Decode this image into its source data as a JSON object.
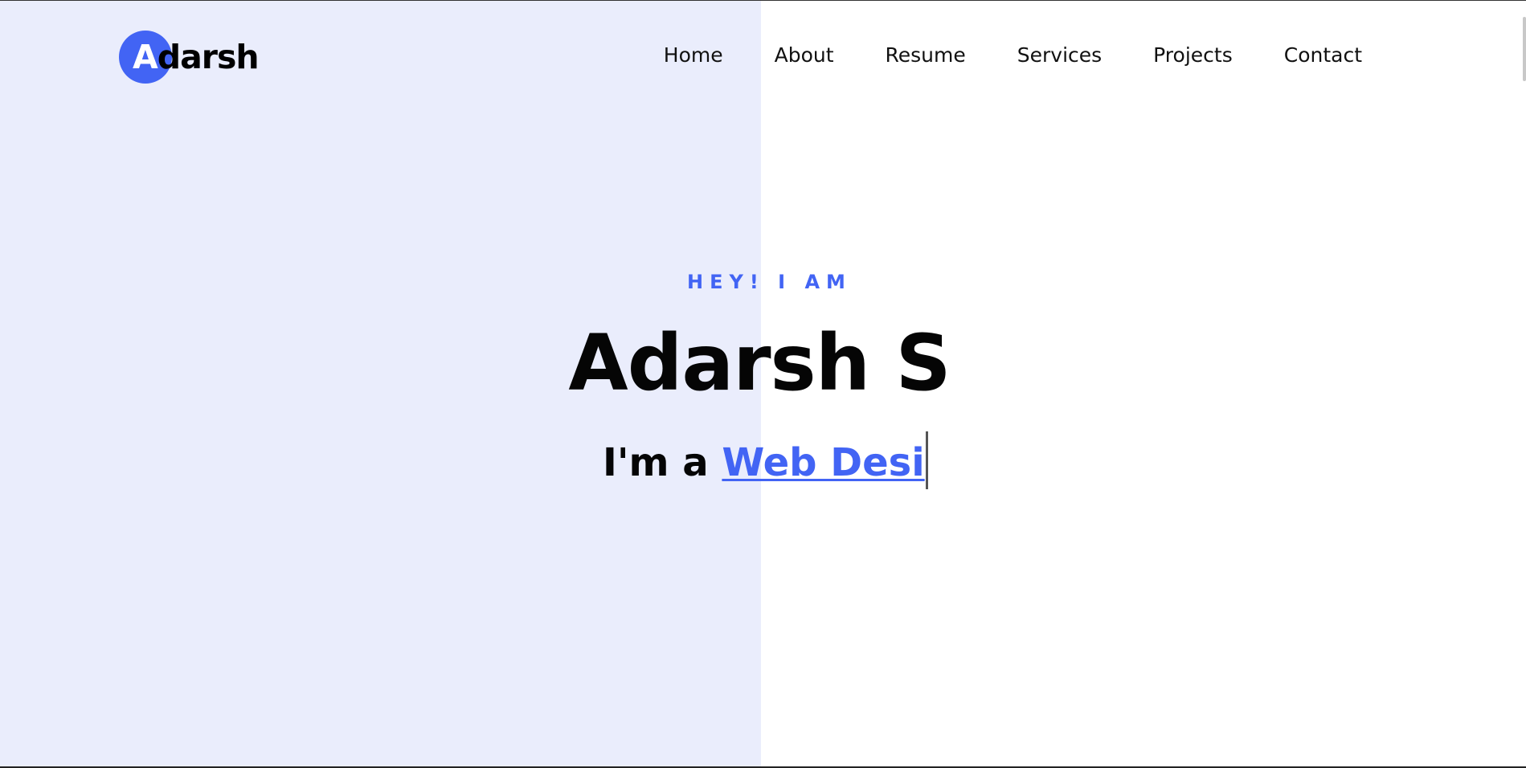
{
  "logo": {
    "first_letter": "A",
    "rest": "darsh",
    "accent_color": "#4264f4"
  },
  "nav": {
    "items": [
      {
        "label": "Home"
      },
      {
        "label": "About"
      },
      {
        "label": "Resume"
      },
      {
        "label": "Services"
      },
      {
        "label": "Projects"
      },
      {
        "label": "Contact"
      }
    ]
  },
  "hero": {
    "eyebrow": "HEY! I AM",
    "name": "Adarsh S",
    "role_prefix": "I'm a",
    "role_typed": "Web Desi"
  },
  "colors": {
    "left_panel_bg": "#eaedfc",
    "accent": "#4264f4",
    "text": "#050505"
  }
}
